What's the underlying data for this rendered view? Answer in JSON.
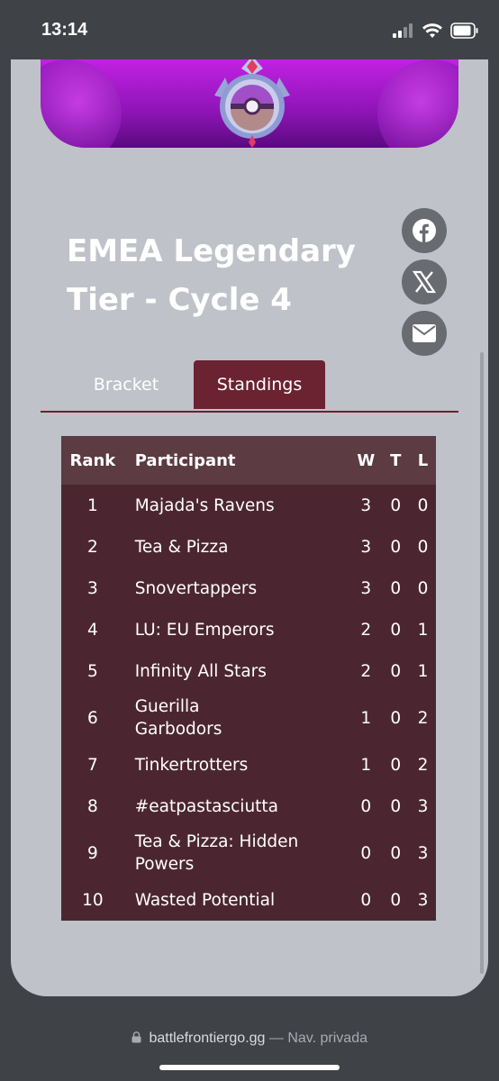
{
  "status": {
    "time": "13:14"
  },
  "page": {
    "title_line1": "EMEA Legendary",
    "title_line2": "Tier - Cycle 4",
    "share_icons": [
      "facebook-icon",
      "x-icon",
      "email-icon"
    ],
    "tabs": [
      {
        "label": "Bracket",
        "active": false
      },
      {
        "label": "Standings",
        "active": true
      }
    ]
  },
  "table": {
    "headers": {
      "rank": "Rank",
      "participant": "Participant",
      "w": "W",
      "t": "T",
      "l": "L"
    },
    "rows": [
      {
        "rank": "1",
        "participant": "Majada's Ravens",
        "w": "3",
        "t": "0",
        "l": "0"
      },
      {
        "rank": "2",
        "participant": "Tea & Pizza",
        "w": "3",
        "t": "0",
        "l": "0"
      },
      {
        "rank": "3",
        "participant": "Snovertappers",
        "w": "3",
        "t": "0",
        "l": "0"
      },
      {
        "rank": "4",
        "participant": "LU: EU Emperors",
        "w": "2",
        "t": "0",
        "l": "1"
      },
      {
        "rank": "5",
        "participant": "Infinity All Stars",
        "w": "2",
        "t": "0",
        "l": "1"
      },
      {
        "rank": "6",
        "participant": "Guerilla Garbodors",
        "w": "1",
        "t": "0",
        "l": "2"
      },
      {
        "rank": "7",
        "participant": "Tinkertrotters",
        "w": "1",
        "t": "0",
        "l": "2"
      },
      {
        "rank": "8",
        "participant": "#eatpastasciutta",
        "w": "0",
        "t": "0",
        "l": "3"
      },
      {
        "rank": "9",
        "participant": "Tea & Pizza: Hidden Powers",
        "w": "0",
        "t": "0",
        "l": "3"
      },
      {
        "rank": "10",
        "participant": "Wasted Potential",
        "w": "0",
        "t": "0",
        "l": "3"
      }
    ]
  },
  "browser": {
    "url": "battlefrontiergo.gg",
    "mode": "— Nav. privada"
  },
  "colors": {
    "accent": "#6b2231",
    "table_bg": "#4b2630",
    "header_bg": "#5c3b43",
    "card_bg": "#bfc2c8"
  }
}
